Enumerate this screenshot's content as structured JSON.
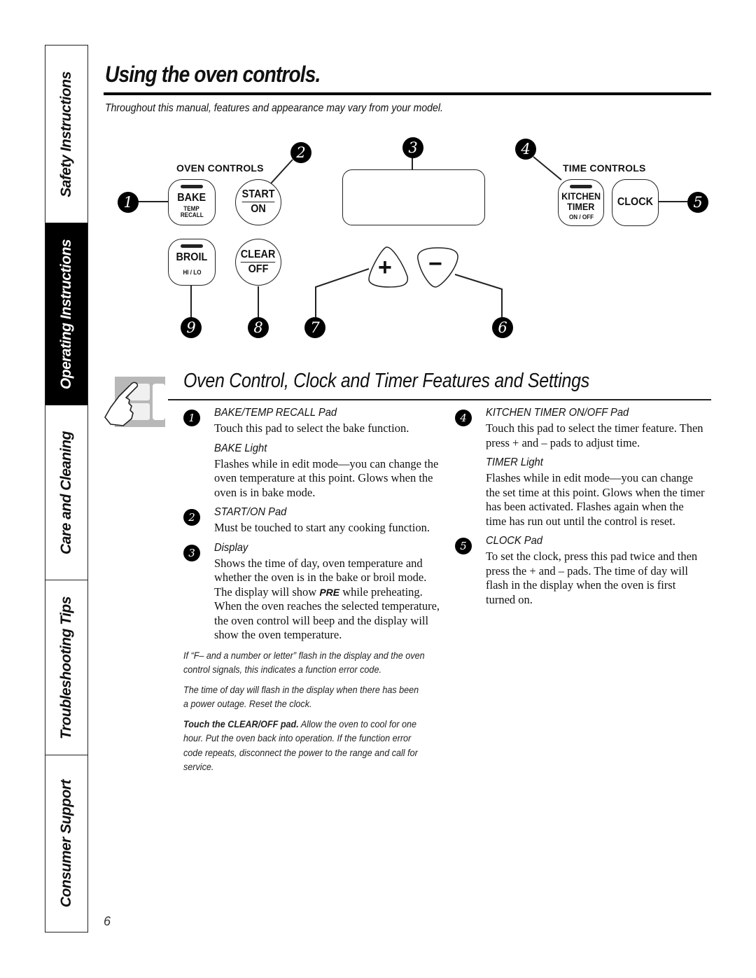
{
  "side_tabs": [
    {
      "label": "Safety Instructions",
      "active": false
    },
    {
      "label": "Operating Instructions",
      "active": true
    },
    {
      "label": "Care and Cleaning",
      "active": false
    },
    {
      "label": "Troubleshooting Tips",
      "active": false
    },
    {
      "label": "Consumer Support",
      "active": false
    }
  ],
  "header": {
    "title": "Using the oven controls.",
    "subtitle": "Throughout this manual, features and appearance may vary from your model."
  },
  "diagram": {
    "oven_controls_label": "OVEN CONTROLS",
    "time_controls_label": "TIME CONTROLS",
    "pads": {
      "bake": {
        "main": "BAKE",
        "sub1": "TEMP",
        "sub2": "RECALL"
      },
      "start": {
        "top": "START",
        "bottom": "ON"
      },
      "broil": {
        "main": "BROIL",
        "sub": "HI / LO"
      },
      "clear": {
        "top": "CLEAR",
        "bottom": "OFF"
      },
      "kitchen_timer": {
        "line1": "KITCHEN",
        "line2": "TIMER",
        "sub": "ON / OFF"
      },
      "clock": {
        "main": "CLOCK"
      },
      "plus": "+",
      "minus": "−"
    },
    "callouts": [
      "1",
      "2",
      "3",
      "4",
      "5",
      "6",
      "7",
      "8",
      "9"
    ]
  },
  "features": {
    "section_title": "Oven Control, Clock and Timer Features and Settings",
    "left_items": [
      {
        "num": "1",
        "head": "BAKE/TEMP RECALL Pad",
        "body": "Touch this pad to select the bake function.",
        "sub_head": "BAKE Light",
        "sub_body": "Flashes while in edit mode—you can change the oven temperature at this point. Glows when the oven is in bake mode."
      },
      {
        "num": "2",
        "head": "START/ON Pad",
        "body": "Must be touched to start any cooking function."
      },
      {
        "num": "3",
        "head": "Display",
        "body_before": "Shows the time of day, oven temperature and whether the oven is in the bake or broil mode. The display will show ",
        "body_em": "PRE",
        "body_after": " while preheating. When the oven reaches the selected temperature, the oven control will beep and the display will show the oven temperature."
      }
    ],
    "notes": [
      {
        "bold": "",
        "text": "If “F– and a number or letter” flash in the display and the oven control signals, this indicates a function error code."
      },
      {
        "bold": "",
        "text": "The time of day will flash in the display when there has been a power outage. Reset the clock."
      },
      {
        "bold": "Touch the CLEAR/OFF pad.",
        "text": " Allow the oven to cool for one hour. Put the oven back into operation. If the function error code repeats, disconnect the power to the range and call for service."
      }
    ],
    "right_items": [
      {
        "num": "4",
        "head": "KITCHEN TIMER ON/OFF Pad",
        "body": "Touch this pad to select the timer feature. Then press + and – pads to adjust time.",
        "sub_head": "TIMER Light",
        "sub_body": "Flashes while in edit mode—you can change the set time at this point. Glows when the timer has been activated. Flashes again when the time has run out until the control is reset."
      },
      {
        "num": "5",
        "head": "CLOCK Pad",
        "body": "To set the clock, press this pad twice and then press the + and – pads. The time of day will flash in the display when the oven is first turned on."
      }
    ]
  },
  "page_number": "6"
}
